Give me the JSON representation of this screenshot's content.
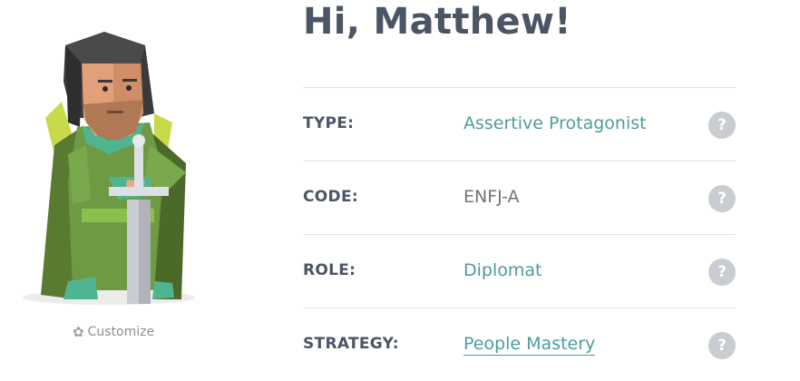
{
  "header": {
    "greeting": "Hi, Matthew!"
  },
  "avatar": {
    "customize_label": "Customize",
    "icon": "gear-icon"
  },
  "profile": {
    "rows": [
      {
        "label": "TYPE:",
        "value": "Assertive Protagonist",
        "help": "?"
      },
      {
        "label": "CODE:",
        "value": "ENFJ-A",
        "help": "?"
      },
      {
        "label": "ROLE:",
        "value": "Diplomat",
        "help": "?"
      },
      {
        "label": "STRATEGY:",
        "value": "People Mastery",
        "help": "?"
      }
    ]
  },
  "colors": {
    "heading": "#4c5566",
    "accent": "#4f9b9b",
    "help_bg": "#c9ccd1"
  }
}
